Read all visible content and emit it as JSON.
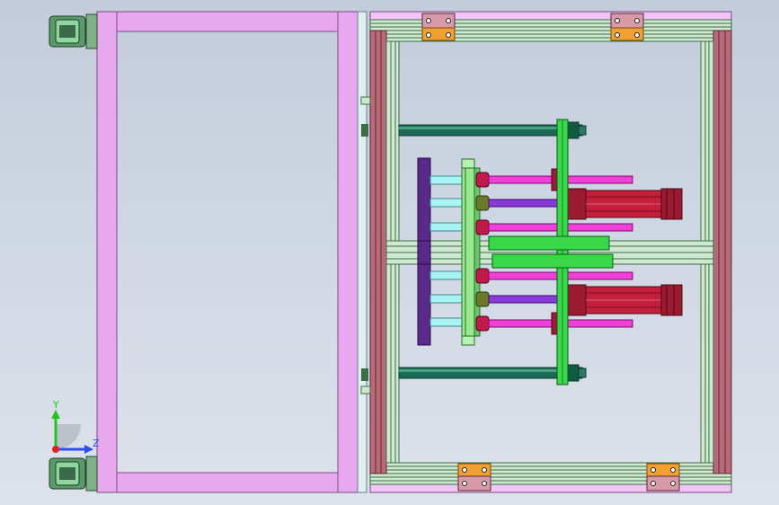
{
  "viewport": {
    "background_top": "#c3ccdc",
    "background_bottom": "#dde2ea"
  },
  "colors": {
    "frame_pink": "#e8a8f0",
    "frame_outline": "#7a4a86",
    "extrusion_green": "#cfe8cf",
    "extrusion_dark": "#3c6e48",
    "extrusion_red": "#b86a78",
    "bracket_orange": "#f0a030",
    "bracket_mauve": "#d89aa8",
    "plate_green": "#38d848",
    "plate_dark_green": "#1c7a2c",
    "light_green": "#98e890",
    "rod_teal": "#1a6a55",
    "rod_magenta": "#f040d8",
    "rod_violet": "#8a3ad8",
    "rod_cyan": "#a8f4f4",
    "plate_purple": "#5a2a8a",
    "cylinder_red": "#c4203c",
    "caster_green": "#5a9a6a",
    "axis_y": "#22c422",
    "axis_z": "#2e4cf0",
    "axis_x": "#e02424"
  },
  "triad": {
    "y_label": "Y",
    "z_label": "Z"
  }
}
